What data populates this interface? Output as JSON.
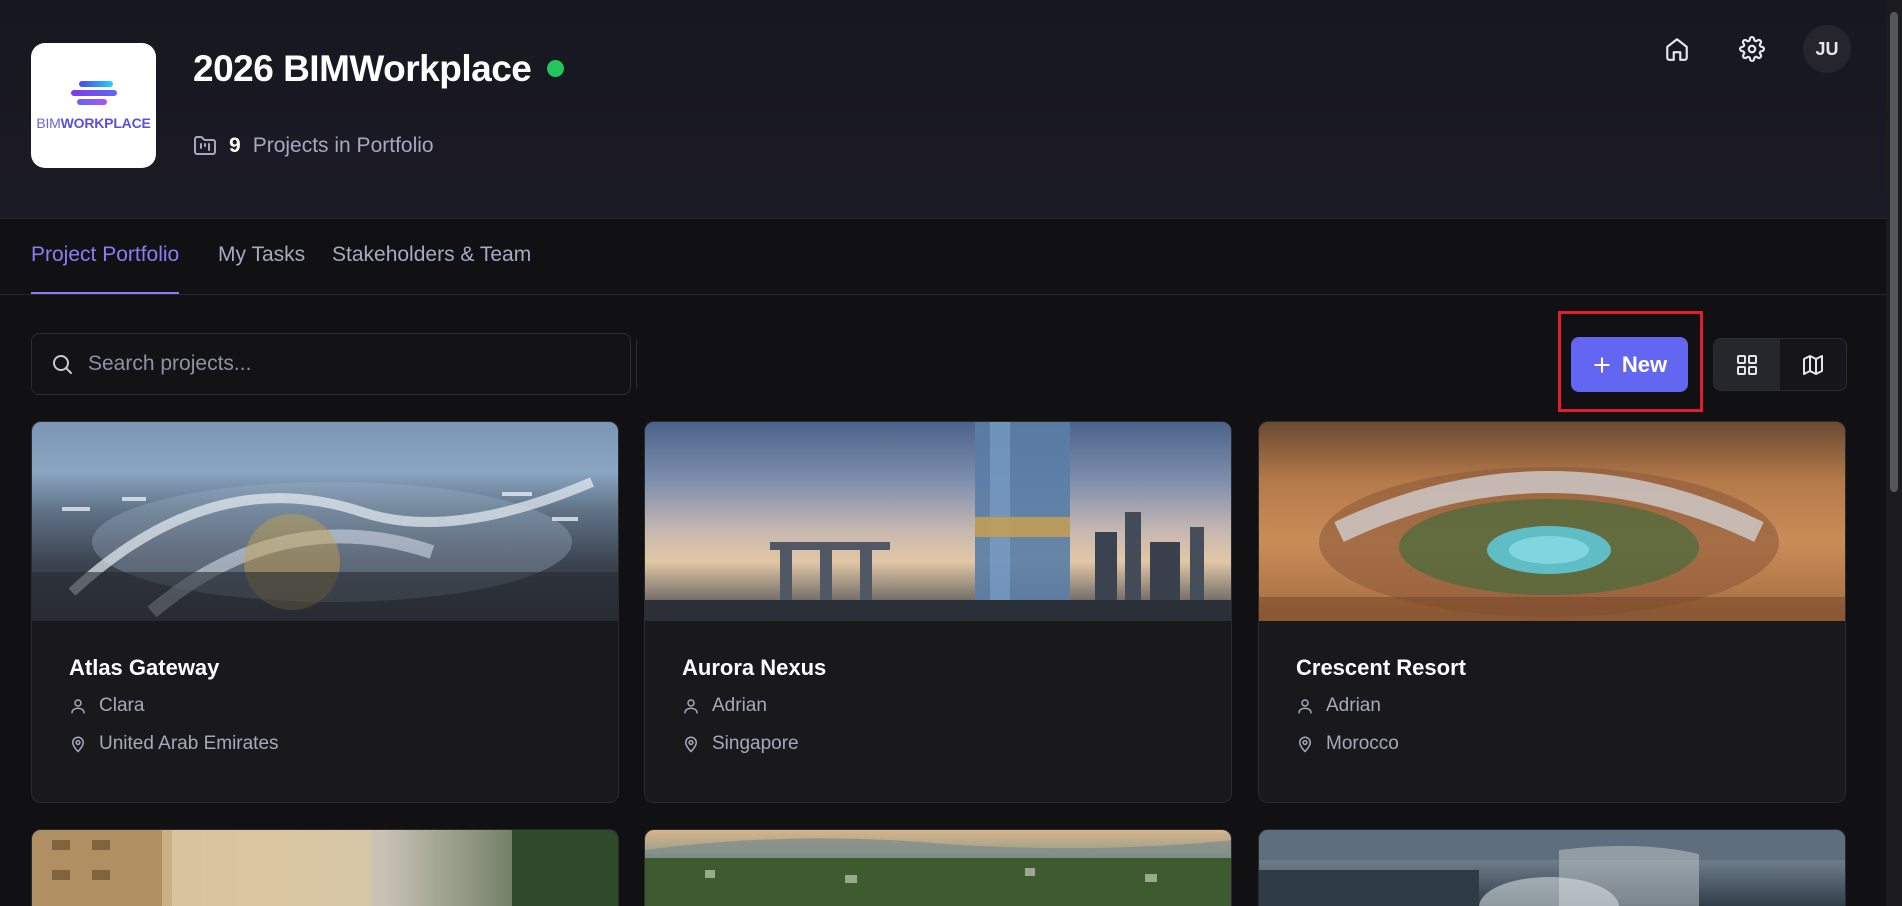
{
  "header": {
    "logo_text_a": "BIM",
    "logo_text_b": "WORKPLACE",
    "title": "2026 BIMWorkplace",
    "status_color": "#22c55e",
    "project_count": "9",
    "project_count_label": "Projects in Portfolio",
    "home_icon": "home-icon",
    "settings_icon": "gear-icon",
    "avatar_initials": "JU"
  },
  "tabs": [
    {
      "label": "Project Portfolio",
      "active": true
    },
    {
      "label": "My Tasks",
      "active": false
    },
    {
      "label": "Stakeholders & Team",
      "active": false
    }
  ],
  "toolbar": {
    "search_placeholder": "Search projects...",
    "new_label": "New",
    "view_grid_icon": "grid-icon",
    "view_map_icon": "map-icon",
    "accent": "#6366f1"
  },
  "projects": [
    {
      "name": "Atlas Gateway",
      "owner": "Clara",
      "location": "United Arab Emirates"
    },
    {
      "name": "Aurora Nexus",
      "owner": "Adrian",
      "location": "Singapore"
    },
    {
      "name": "Crescent Resort",
      "owner": "Adrian",
      "location": "Morocco"
    }
  ]
}
